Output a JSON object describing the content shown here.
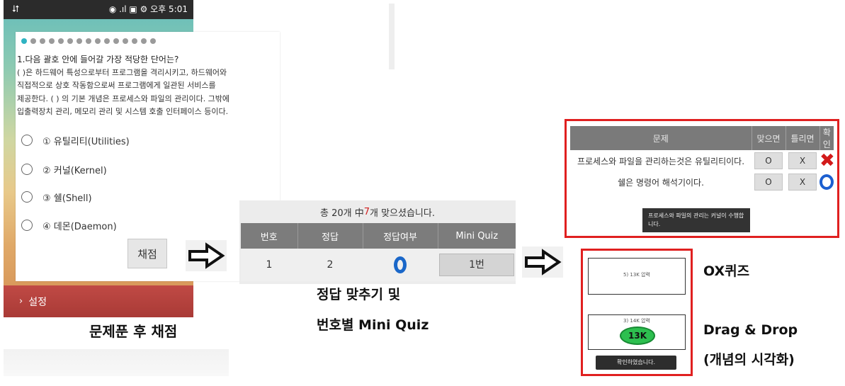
{
  "status_bar": {
    "usb_icon": "usb-icon",
    "indicators": "◉ .ıl ▣ ⚙",
    "time": "오후 5:01"
  },
  "quiz": {
    "dot_count": 15,
    "question_title": "1.다음 괄호 안에 들어갈 가장 적당한 단어는?",
    "question_lines": [
      "( )은 하드웨어 특성으로부터 프로그램을 격리시키고, 하드웨어와",
      "직접적으로 상호 작동함으로써 프로그램에게 일관된 서비스를",
      "제공한다. ( ) 의 기본 개념은 프로세스와 파일의 관리이다. 그밖에",
      "입출력장치 관리, 메모리 관리 및 시스템 호출 인터페이스 등이다."
    ],
    "options": [
      "① 유틸리티(Utilities)",
      "② 커널(Kernel)",
      "③ 쉘(Shell)",
      "④ 데몬(Daemon)"
    ],
    "grade_button": "채점",
    "settings_label": "설정"
  },
  "captions": {
    "step1": "문제푼 후 채점",
    "step2_line1": "정답 맞추기 및",
    "step2_line2": "번호별 Mini Quiz",
    "ox_quiz": "OX퀴즈",
    "drag_drop": "Drag & Drop",
    "drag_drop_sub": "(개념의 시각화)"
  },
  "result": {
    "summary_prefix": "총 20개 中 ",
    "summary_count": "7",
    "summary_suffix": "개 맞으셨습니다.",
    "columns": [
      "번호",
      "정답",
      "정답여부",
      "Mini Quiz"
    ],
    "rows": [
      {
        "number": "1",
        "answer": "2",
        "correct_icon": "blue-o-icon",
        "mini_quiz": "1번"
      }
    ]
  },
  "ox": {
    "columns": [
      "문제",
      "맞으면",
      "틀리면",
      "확인"
    ],
    "rows": [
      {
        "question": "프로세스와 파일을 관리하는것은 유틸리티이다.",
        "o": "O",
        "x": "X",
        "result_icon": "red-x-icon"
      },
      {
        "question": "쉘은 명령어 해석기이다.",
        "o": "O",
        "x": "X",
        "result_icon": "blue-o-icon"
      }
    ],
    "tooltip": "프로세스와 파일의 관리는 커널이 수행합니다."
  },
  "drag_drop": {
    "card1_text": "5) 13K 압력",
    "card2_text": "3) 14K 압력",
    "badge": "13K",
    "button": "확인하였습니다."
  },
  "colors": {
    "frame_red": "#e02020",
    "quiz_blue": "#1a67c9",
    "badge_green": "#2dbf4f",
    "settings_red": "#b8433f"
  }
}
